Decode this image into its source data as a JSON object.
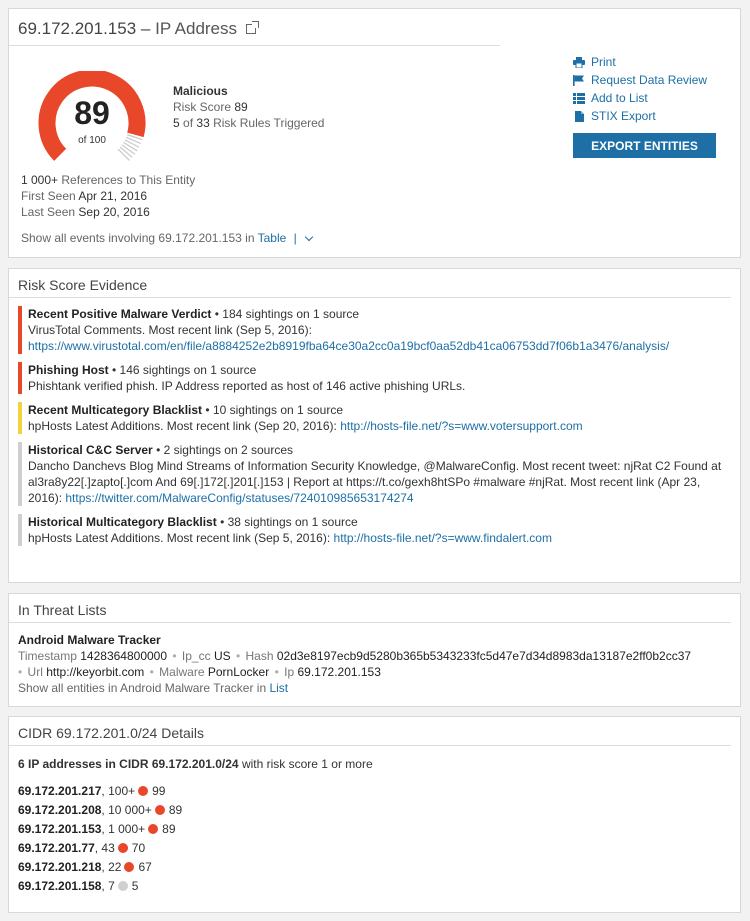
{
  "header": {
    "ip": "69.172.201.153",
    "dash": "–",
    "type": "IP Address"
  },
  "gauge": {
    "score": "89",
    "of": "of 100",
    "fraction": 0.89,
    "color": "#e8472a"
  },
  "verdict": {
    "title": "Malicious",
    "risk_label": "Risk Score",
    "risk_value": "89",
    "rules_triggered": "5",
    "rules_of": "of",
    "rules_total": "33",
    "rules_label": "Risk Rules Triggered"
  },
  "actions": {
    "print": "Print",
    "review": "Request Data Review",
    "add_list": "Add to List",
    "stix": "STIX Export",
    "export": "EXPORT ENTITIES"
  },
  "refs": {
    "count": "1 000+",
    "count_label": "References to This Entity",
    "first_label": "First Seen",
    "first_value": "Apr 21, 2016",
    "last_label": "Last Seen",
    "last_value": "Sep 20, 2016"
  },
  "showall": {
    "text": "Show all events involving 69.172.201.153 in",
    "link": "Table",
    "pipe": "|"
  },
  "evidence": {
    "title": "Risk Score Evidence",
    "items": [
      {
        "name": "Recent Positive Malware Verdict",
        "sightings": "• 184 sightings on 1 source",
        "body": "VirusTotal Comments. Most recent link (Sep 5, 2016):",
        "link": "https://www.virustotal.com/en/file/a8884252e2b8919fba64ce30a2cc0a19bcf0aa52db41ca06753dd7f06b1a3476/analysis/",
        "color": "#e8472a"
      },
      {
        "name": "Phishing Host",
        "sightings": "• 146 sightings on 1 source",
        "body": "Phishtank verified phish. IP Address reported as host of 146 active phishing URLs.",
        "link": "",
        "color": "#e8472a"
      },
      {
        "name": "Recent Multicategory Blacklist",
        "sightings": "• 10 sightings on 1 source",
        "body": "hpHosts Latest Additions. Most recent link (Sep 20, 2016):",
        "link": "http://hosts-file.net/?s=www.votersupport.com",
        "color": "#f2d33c"
      },
      {
        "name": "Historical C&C Server",
        "sightings": "• 2 sightings on 2 sources",
        "body": "Dancho Danchevs Blog Mind Streams of Information Security Knowledge, @MalwareConfig. Most recent tweet: njRat C2 Found at al3ra8y22[.]zapto[.]com And 69[.]172[.]201[.]153 | Report at https://t.co/gexh8htSPo #malware #njRat. Most recent link (Apr 23, 2016):",
        "link": "https://twitter.com/MalwareConfig/statuses/724010985653174274",
        "color": "#cfcfcf"
      },
      {
        "name": "Historical Multicategory Blacklist",
        "sightings": "• 38 sightings on 1 source",
        "body": "hpHosts Latest Additions. Most recent link (Sep 5, 2016):",
        "link": "http://hosts-file.net/?s=www.findalert.com",
        "color": "#cfcfcf"
      }
    ]
  },
  "threat": {
    "title": "In Threat Lists",
    "name": "Android Malware Tracker",
    "fields": {
      "timestamp_key": "Timestamp",
      "timestamp_val": "1428364800000",
      "ipcc_key": "Ip_cc",
      "ipcc_val": "US",
      "hash_key": "Hash",
      "hash_val": "02d3e8197ecb9d5280b365b5343233fc5d47e7d34d8983da13187e2ff0b2cc37",
      "url_key": "Url",
      "url_val": "http://keyorbit.com",
      "malware_key": "Malware",
      "malware_val": "PornLocker",
      "ip_key": "Ip",
      "ip_val": "69.172.201.153"
    },
    "bullet": "•",
    "showall_text": "Show all entities in Android Malware Tracker in",
    "showall_link": "List"
  },
  "cidr": {
    "title": "CIDR 69.172.201.0/24 Details",
    "head_bold": "6 IP addresses in CIDR 69.172.201.0/24",
    "head_rest": "with risk score 1 or more",
    "rows": [
      {
        "ip": "69.172.201.217",
        "refs": ", 100+",
        "score": "99",
        "color": "#e8472a"
      },
      {
        "ip": "69.172.201.208",
        "refs": ", 10 000+",
        "score": "89",
        "color": "#e8472a"
      },
      {
        "ip": "69.172.201.153",
        "refs": ", 1 000+",
        "score": "89",
        "color": "#e8472a"
      },
      {
        "ip": "69.172.201.77",
        "refs": ", 43",
        "score": "70",
        "color": "#e8472a"
      },
      {
        "ip": "69.172.201.218",
        "refs": ", 22",
        "score": "67",
        "color": "#e8472a"
      },
      {
        "ip": "69.172.201.158",
        "refs": ", 7",
        "score": "5",
        "color": "#d0d0d0"
      }
    ]
  }
}
